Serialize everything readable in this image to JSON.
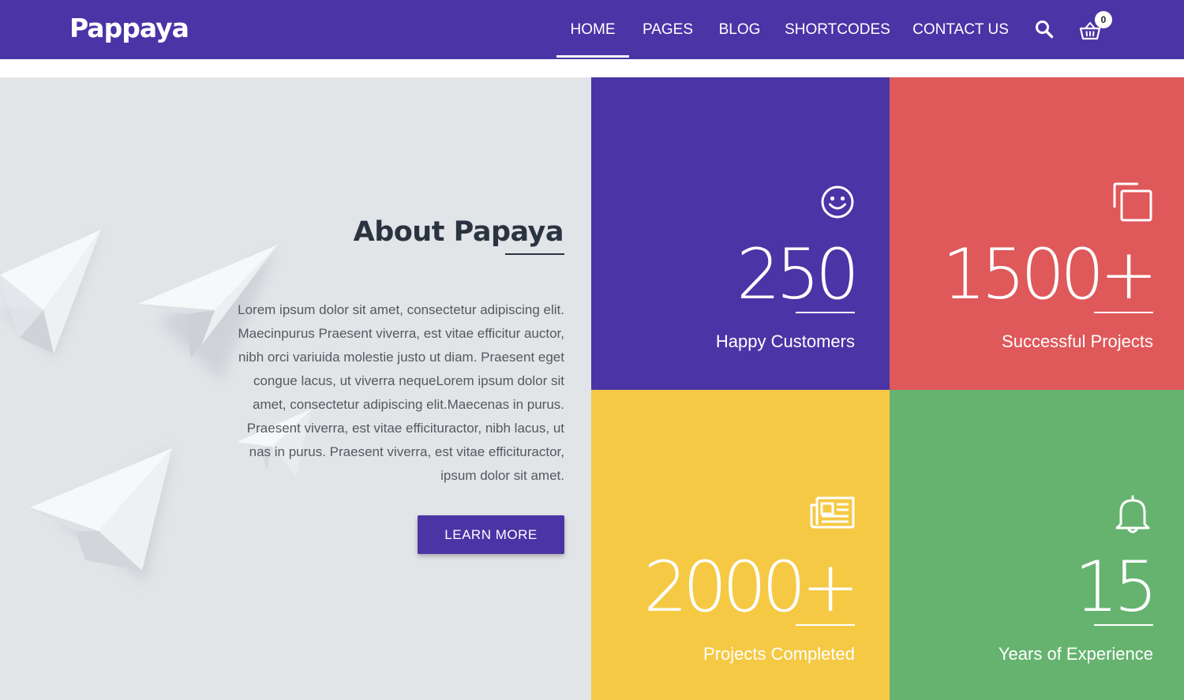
{
  "header": {
    "logo": "Pappaya",
    "nav": [
      "HOME",
      "PAGES",
      "BLOG",
      "SHORTCODES",
      "CONTACT US"
    ],
    "active_nav": "HOME",
    "cart_count": "0"
  },
  "about": {
    "title": "About Papaya",
    "text": "Lorem ipsum dolor sit amet, consectetur adipiscing elit. Maecinpurus Praesent viverra, est vitae efficitur auctor, nibh orci variuida molestie justo ut diam. Praesent eget congue lacus, ut viverra nequeLorem ipsum dolor sit amet, consectetur adipiscing elit.Maecenas in purus. Praesent viverra, est vitae efficituractor, nibh lacus, ut nas in purus. Praesent viverra, est vitae efficituractor, ipsum dolor sit amet.",
    "button": "LEARN MORE"
  },
  "stats": [
    {
      "number": "250",
      "label": "Happy Customers",
      "icon": "smiley-icon",
      "color": "#4b34a6"
    },
    {
      "number": "1500+",
      "label": "Successful Projects",
      "icon": "copy-icon",
      "color": "#df585a"
    },
    {
      "number": "2000+",
      "label": "Projects Completed",
      "icon": "newspaper-icon",
      "color": "#f5c944"
    },
    {
      "number": "15",
      "label": "Years of Experience",
      "icon": "bell-icon",
      "color": "#65b36f"
    }
  ],
  "colors": {
    "brand_purple": "#4b34a6",
    "panel_bg": "#e2e5e8",
    "heading": "#2a3441",
    "body_text": "#55585e"
  }
}
